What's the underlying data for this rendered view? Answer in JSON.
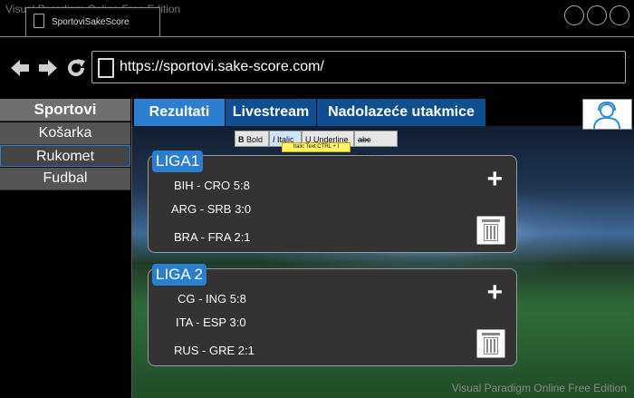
{
  "watermark": "Visual Paradigm Online Free Edition",
  "browser": {
    "tab_title": "SportoviSakeScore",
    "url": "https://sportovi.sake-score.com/"
  },
  "sidebar": {
    "items": [
      {
        "label": "Sportovi"
      },
      {
        "label": "Košarka"
      },
      {
        "label": "Rukomet"
      },
      {
        "label": "Fudbal"
      }
    ]
  },
  "tabs": [
    {
      "label": "Rezultati"
    },
    {
      "label": "Livestream"
    },
    {
      "label": "Nadolazeće utakmice"
    }
  ],
  "format_toolbar": {
    "bold": {
      "icon": "B",
      "label": "Bold"
    },
    "italic": {
      "icon": "I",
      "label": "Italic"
    },
    "underline": {
      "icon": "U",
      "label": "Underline"
    },
    "strike": {
      "icon": "abc",
      "label": "Striken"
    },
    "tooltip": "Italic Text CTRL + I"
  },
  "leagues": [
    {
      "title": "LIGA1",
      "matches": [
        "BIH - CRO 5:8",
        "ARG - SRB  3:0",
        "BRA - FRA 2:1"
      ]
    },
    {
      "title": "LIGA 2",
      "matches": [
        "CG - ING 5:8",
        "ITA - ESP  3:0",
        "RUS - GRE 2:1"
      ]
    }
  ],
  "icons": {
    "back": "arrow-left-icon",
    "forward": "arrow-right-icon",
    "reload": "reload-icon",
    "add": "plus-icon",
    "delete": "trash-icon",
    "avatar": "user-avatar-icon"
  },
  "colors": {
    "tab_active": "#2c7fd0",
    "tab_inactive": "#0e4f92",
    "card_bg": "#333333",
    "sidebar_item": "#555555"
  }
}
